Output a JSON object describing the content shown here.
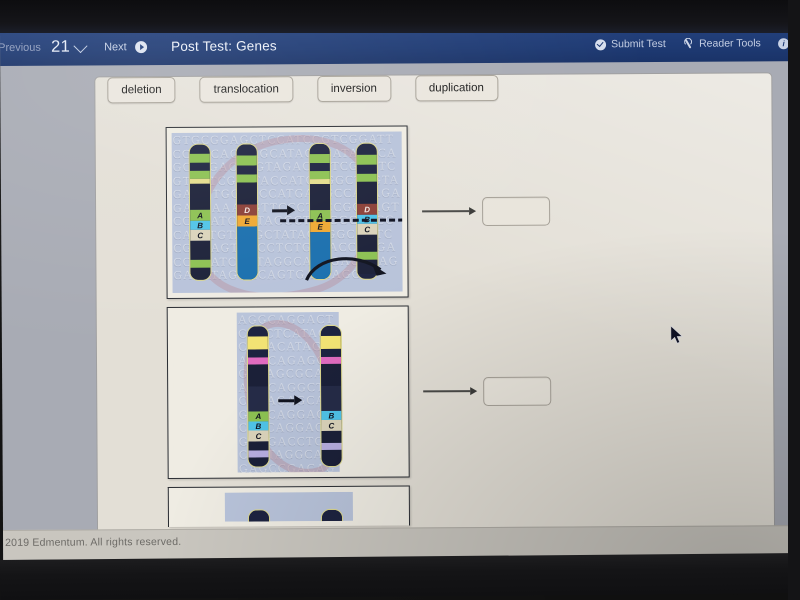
{
  "topbar": {
    "previous_label": "Previous",
    "page_number": "21",
    "next_label": "Next",
    "test_title": "Post Test: Genes",
    "submit_label": "Submit Test",
    "reader_tools_label": "Reader Tools",
    "info_label": "In",
    "bg_color": "#1e3a73"
  },
  "answer_choices": [
    {
      "label": "deletion"
    },
    {
      "label": "translocation"
    },
    {
      "label": "inversion"
    },
    {
      "label": "duplication"
    }
  ],
  "questions": [
    {
      "id": "q1",
      "diagram_type": "translocation",
      "answer_value": "",
      "chromosomes": [
        {
          "name": "chr-1-before",
          "genes": [
            "A",
            "B",
            "C"
          ]
        },
        {
          "name": "chr-2-before",
          "genes": [
            "D",
            "E"
          ]
        },
        {
          "name": "chr-1-after",
          "genes": [
            "A",
            "E"
          ]
        },
        {
          "name": "chr-2-after",
          "genes": [
            "D",
            "B",
            "C"
          ]
        }
      ],
      "watermark": "GTGCGGAGCTCCATCCGTCGGATTCCGGCAGGAGCATAGCCATAGCCAGCTTGACTAGTAGACAGTCGAGTCGTCATCGTATACCATGAGGCTCGTAGAGGTGCCACCATGAGGCCACAGAGACGAAAGGTTCCCTGCCGGCAGTCCGCATCGGTAGGCTCTGGCTCCGCATCTGTAGGCTATAGAGGCAGTCCGCCAGTGTCCTCTGCTACCAGGACCACATCCGTAGGCAGTGACGCAGGACATAGGACAGTGACTAGG"
    },
    {
      "id": "q2",
      "diagram_type": "deletion",
      "answer_value": "",
      "chromosomes": [
        {
          "name": "chr-before",
          "genes": [
            "A",
            "B",
            "C"
          ]
        },
        {
          "name": "chr-after",
          "genes": [
            "B",
            "C"
          ]
        }
      ],
      "watermark": "AGGCAGGACTCTCCTCATAGCCAGACATAGCAGACAGAGCAGTCAGCGCAGAGACAGGCTCCGCAGAGCAGGCGCAGGAGACGTCAGGACAGCAGACCTGCCACTAGGCACGAGCCGACAGTCACAGTACCAGGCCAGGATCAGCACAGGAGGCC"
    },
    {
      "id": "q3",
      "diagram_type": "partial",
      "answer_value": ""
    }
  ],
  "footer": {
    "copyright": "2019 Edmentum. All rights reserved."
  },
  "icons": {
    "chevron_down": "chevron-down-icon",
    "next": "next-circle-icon",
    "submit": "check-circle-icon",
    "reader": "wrench-icon",
    "info": "info-icon",
    "cursor": "mouse-pointer-icon"
  }
}
